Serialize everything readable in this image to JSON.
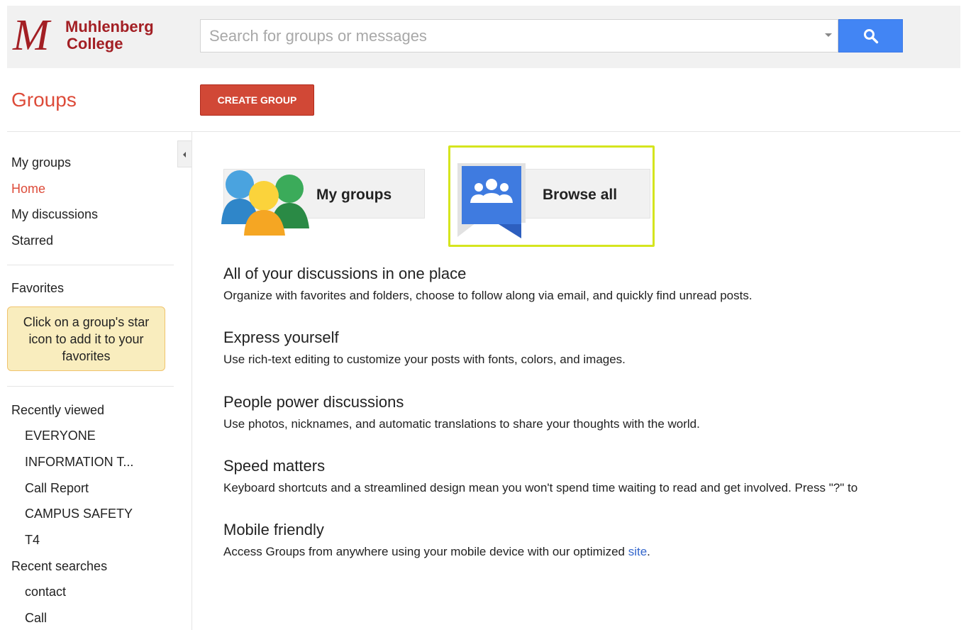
{
  "brand": {
    "logo_letter": "M",
    "line1": "Muhlenberg",
    "line2": "College"
  },
  "search": {
    "placeholder": "Search for groups or messages",
    "icon": "search-icon"
  },
  "header": {
    "title": "Groups",
    "create_button": "CREATE GROUP"
  },
  "sidebar": {
    "nav": [
      "My groups",
      "Home",
      "My discussions",
      "Starred"
    ],
    "active": "Home",
    "favorites_label": "Favorites",
    "favorites_note": "Click on a group's star icon to add it to your favorites",
    "recently_viewed_label": "Recently viewed",
    "recently_viewed": [
      "EVERYONE",
      "INFORMATION T...",
      "Call Report",
      "CAMPUS SAFETY",
      "T4"
    ],
    "recent_searches_label": "Recent searches",
    "recent_searches": [
      "contact",
      "Call"
    ]
  },
  "tiles": {
    "my_groups": {
      "label": "My groups",
      "icon": "people-icon"
    },
    "browse_all": {
      "label": "Browse all",
      "icon": "browse-groups-icon"
    }
  },
  "features": [
    {
      "title": "All of your discussions in one place",
      "desc": "Organize with favorites and folders, choose to follow along via email, and quickly find unread posts."
    },
    {
      "title": "Express yourself",
      "desc": "Use rich-text editing to customize your posts with fonts, colors, and images."
    },
    {
      "title": "People power discussions",
      "desc": "Use photos, nicknames, and automatic translations to share your thoughts with the world."
    },
    {
      "title": "Speed matters",
      "desc": "Keyboard shortcuts and a streamlined design mean you won't spend time waiting to read and get involved. Press \"?\" to"
    },
    {
      "title": "Mobile friendly",
      "desc": "Access Groups from anywhere using your mobile device with our optimized ",
      "link": "site",
      "after_link": "."
    }
  ],
  "colors": {
    "brand_red": "#a31f24",
    "accent_red": "#dd4b39",
    "search_blue": "#4285f4",
    "highlight": "#d5e51e",
    "note_bg": "#f9edbe",
    "link": "#3366cc"
  }
}
